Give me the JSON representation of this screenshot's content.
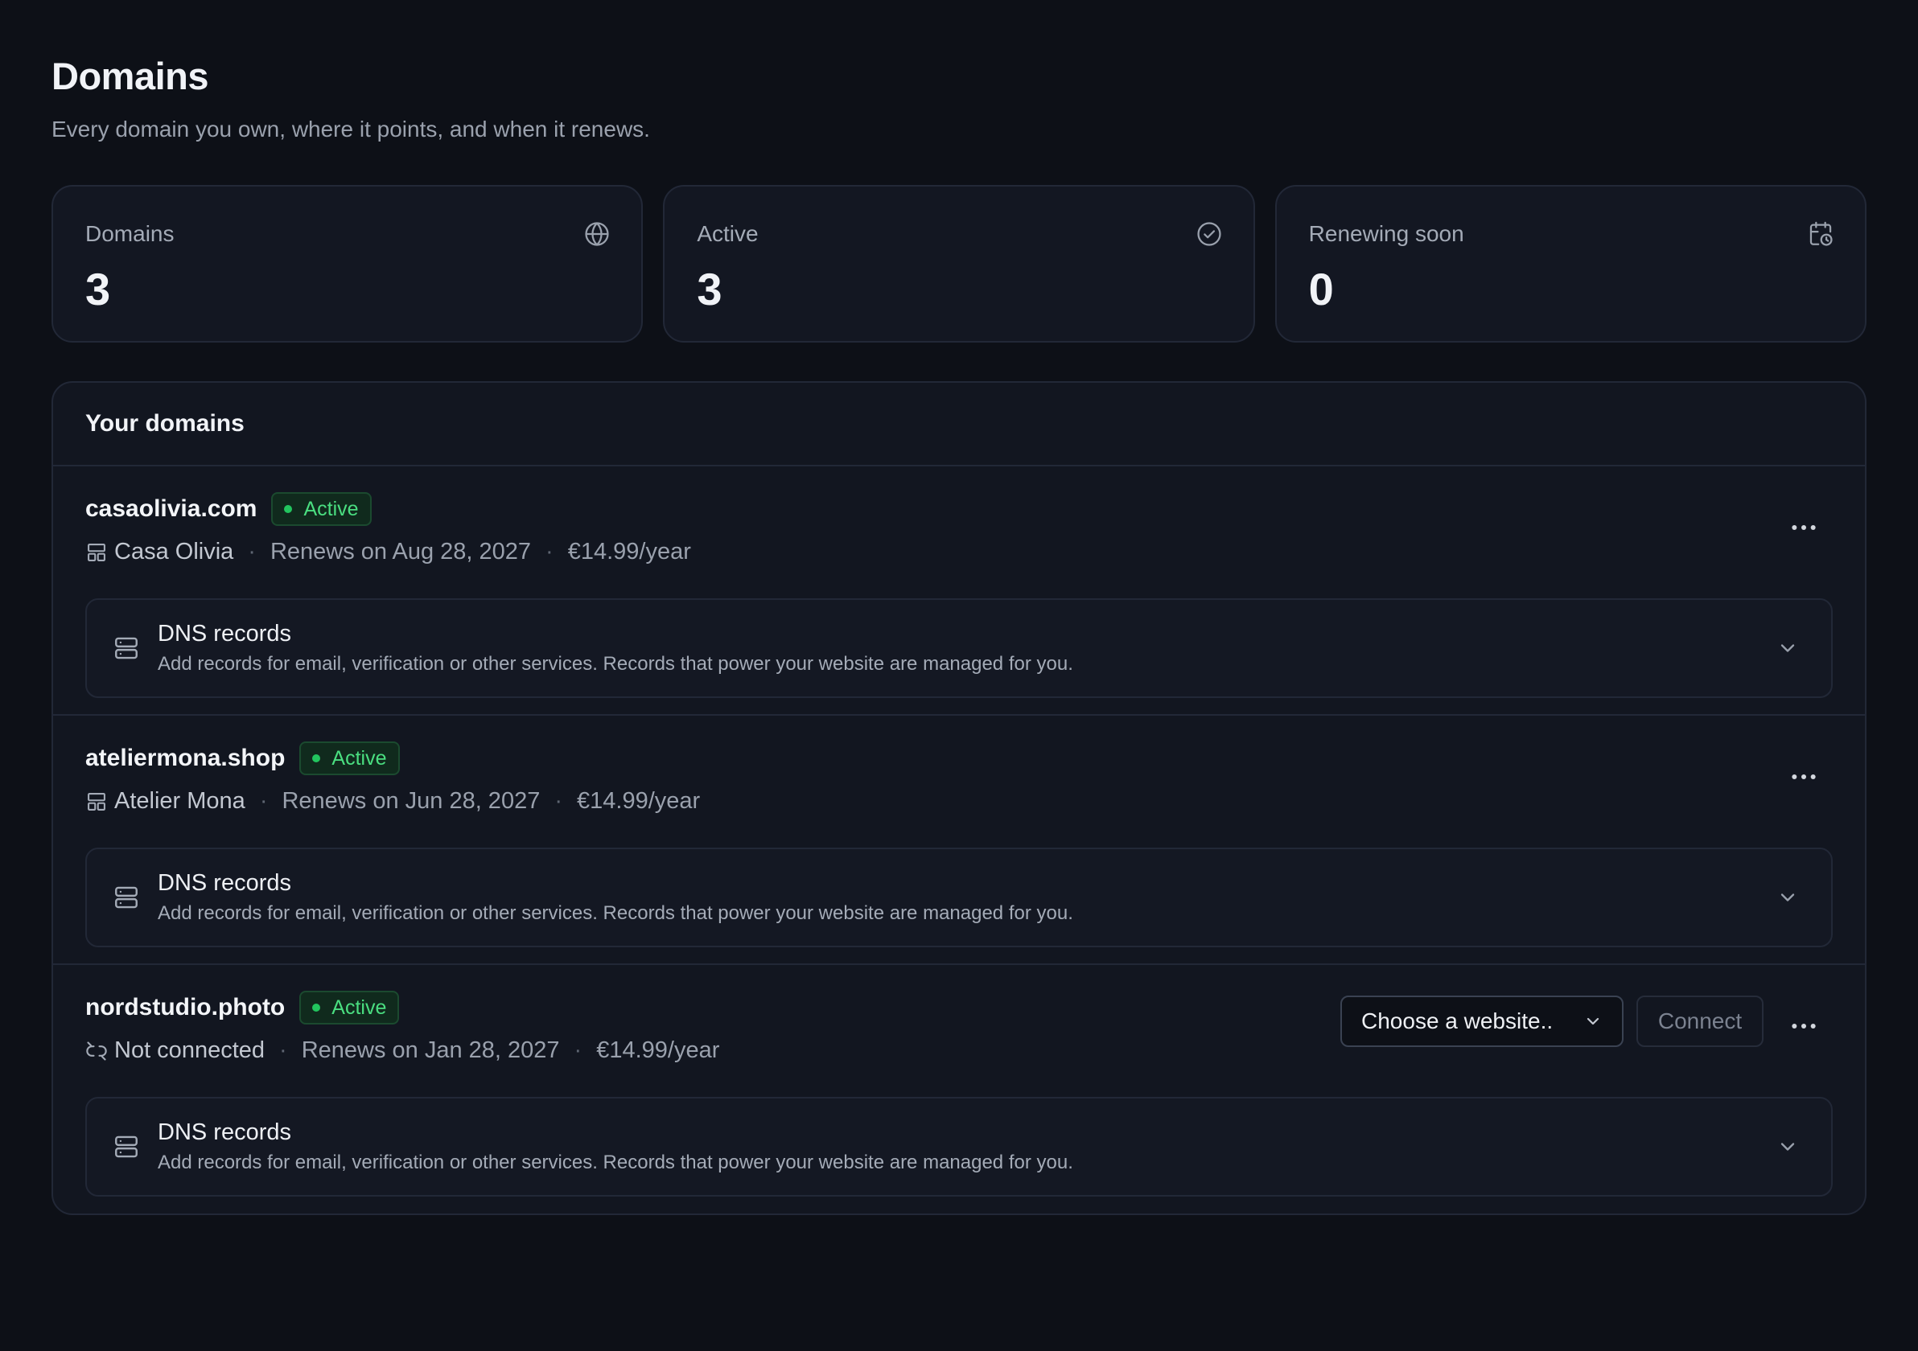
{
  "page": {
    "title": "Domains",
    "subtitle": "Every domain you own, where it points, and when it renews."
  },
  "stats": [
    {
      "label": "Domains",
      "value": "3",
      "icon": "globe-icon"
    },
    {
      "label": "Active",
      "value": "3",
      "icon": "check-circle-icon"
    },
    {
      "label": "Renewing soon",
      "value": "0",
      "icon": "calendar-clock-icon"
    }
  ],
  "domains_card": {
    "title": "Your domains",
    "separator": "·",
    "items": [
      {
        "name": "casaolivia.com",
        "status": "Active",
        "website": "Casa Olivia",
        "site_icon": "layout-icon",
        "renews": "Renews on Aug 28, 2027",
        "price": "€14.99/year",
        "dns_title": "DNS records",
        "dns_desc": "Add records for email, verification or other services. Records that power your website are managed for you."
      },
      {
        "name": "ateliermona.shop",
        "status": "Active",
        "website": "Atelier Mona",
        "site_icon": "layout-icon",
        "renews": "Renews on Jun 28, 2027",
        "price": "€14.99/year",
        "dns_title": "DNS records",
        "dns_desc": "Add records for email, verification or other services. Records that power your website are managed for you."
      },
      {
        "name": "nordstudio.photo",
        "status": "Active",
        "website": "Not connected",
        "site_icon": "unlink-icon",
        "renews": "Renews on Jan 28, 2027",
        "price": "€14.99/year",
        "select_label": "Choose a website..",
        "connect_label": "Connect",
        "dns_title": "DNS records",
        "dns_desc": "Add records for email, verification or other services. Records that power your website are managed for you."
      }
    ]
  },
  "colors": {
    "background": "#0d1017",
    "card": "#131722",
    "border": "#222837",
    "status_green": "#4ade80"
  }
}
